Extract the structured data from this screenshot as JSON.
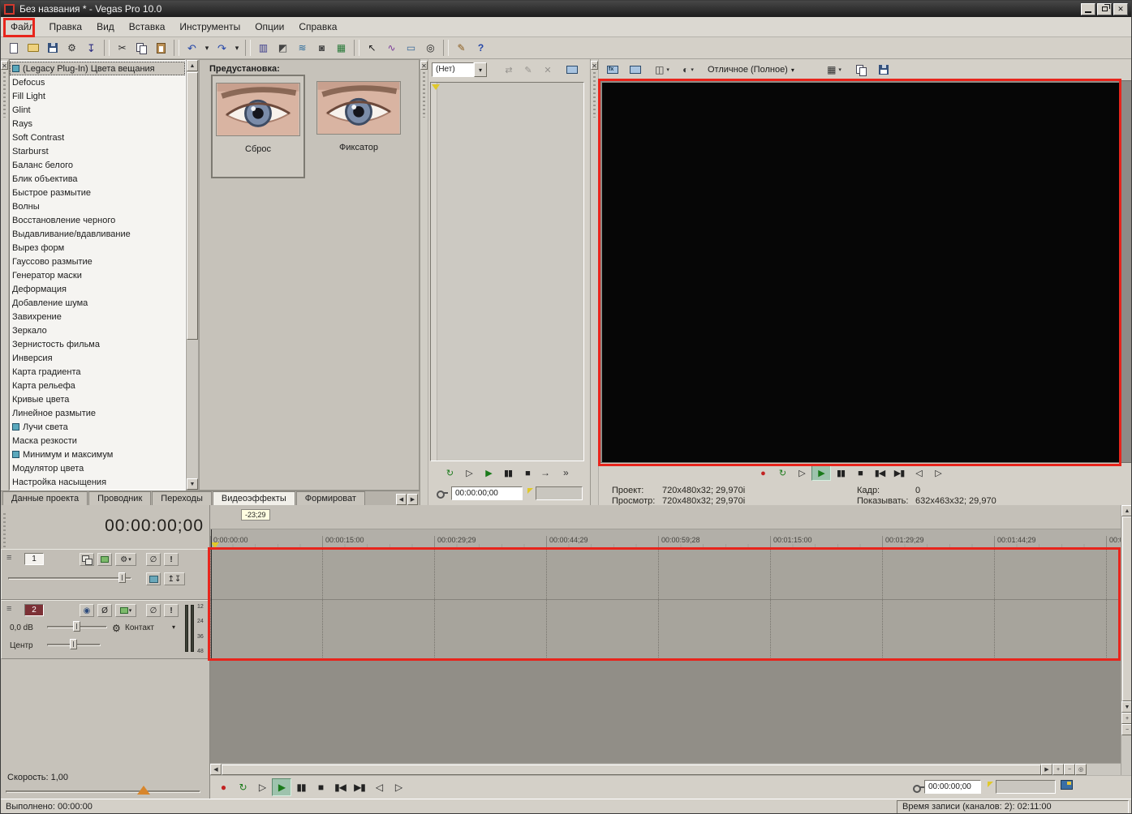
{
  "window": {
    "title": "Без названия * - Vegas Pro 10.0"
  },
  "icons": {
    "close": "✕",
    "combo_arrow": "▾",
    "collapse": "≡",
    "gear": "⚙",
    "mute": "∅",
    "solo": "!",
    "record_arm": "◉",
    "invert_phase": "Ø",
    "kf_sync": "⇄",
    "kf_edit": "✎",
    "kf_delete": "✕",
    "jump": "→",
    "more": "»",
    "split_screen": "◫",
    "preview_color": "◐",
    "grid": "▦",
    "arrow_left": "◀",
    "arrow_right": "▶",
    "arrow_up": "▲",
    "arrow_down": "▼",
    "plus": "+",
    "minus": "−",
    "zoom_tool": "◎",
    "child_up": "↥",
    "child_down": "↧"
  },
  "menu": {
    "items": [
      {
        "name": "menu-file",
        "label": "Файл"
      },
      {
        "name": "menu-edit",
        "label": "Правка"
      },
      {
        "name": "menu-view",
        "label": "Вид"
      },
      {
        "name": "menu-insert",
        "label": "Вставка"
      },
      {
        "name": "menu-tools",
        "label": "Инструменты"
      },
      {
        "name": "menu-options",
        "label": "Опции"
      },
      {
        "name": "menu-help",
        "label": "Справка"
      }
    ]
  },
  "toolbar": {
    "items": [
      {
        "name": "new-project-button",
        "icon": "page"
      },
      {
        "name": "open-button",
        "icon": "folder"
      },
      {
        "name": "save-button",
        "icon": "floppy"
      },
      {
        "name": "properties-button",
        "icon": "props"
      },
      {
        "name": "import-media-button",
        "icon": "import"
      },
      {
        "name": "toolbar-separator",
        "kind": "sep",
        "inter": false
      },
      {
        "name": "cut-button",
        "icon": "cut"
      },
      {
        "name": "copy-button",
        "icon": "copy"
      },
      {
        "name": "paste-button",
        "icon": "paste"
      },
      {
        "name": "toolbar-separator",
        "kind": "sep",
        "inter": false
      },
      {
        "name": "undo-button",
        "icon": "undo"
      },
      {
        "name": "undo-dropdown",
        "icon": "dd",
        "kind": "dd"
      },
      {
        "name": "redo-button",
        "icon": "redo"
      },
      {
        "name": "redo-dropdown",
        "icon": "dd",
        "kind": "dd"
      },
      {
        "name": "toolbar-separator",
        "kind": "sep",
        "inter": false
      },
      {
        "name": "snapping-button",
        "icon": "snap"
      },
      {
        "name": "auto-crossfades-button",
        "icon": "xfade"
      },
      {
        "name": "auto-ripple-button",
        "icon": "ripple"
      },
      {
        "name": "lock-envelopes-button",
        "icon": "lockenv"
      },
      {
        "name": "ignore-grouping-button",
        "icon": "group"
      },
      {
        "name": "toolbar-separator",
        "kind": "sep",
        "inter": false
      },
      {
        "name": "normal-edit-tool-button",
        "icon": "arrowtool"
      },
      {
        "name": "envelope-tool-button",
        "icon": "envtool"
      },
      {
        "name": "selection-tool-button",
        "icon": "seltool"
      },
      {
        "name": "zoom-tool-button",
        "icon": "zoomtool"
      },
      {
        "name": "toolbar-separator",
        "kind": "sep",
        "inter": false
      },
      {
        "name": "tutorials-button",
        "icon": "tutorial"
      },
      {
        "name": "whats-this-button",
        "icon": "help"
      }
    ]
  },
  "effects": {
    "items": [
      {
        "label": "(Legacy Plug-In) Цвета вещания",
        "selected": true,
        "icon": "plugin"
      },
      {
        "label": "Defocus"
      },
      {
        "label": "Fill Light"
      },
      {
        "label": "Glint"
      },
      {
        "label": "Rays"
      },
      {
        "label": "Soft Contrast"
      },
      {
        "label": "Starburst"
      },
      {
        "label": "Баланс белого"
      },
      {
        "label": "Блик объектива"
      },
      {
        "label": "Быстрое размытие"
      },
      {
        "label": "Волны"
      },
      {
        "label": "Восстановление черного"
      },
      {
        "label": "Выдавливание/вдавливание"
      },
      {
        "label": "Вырез форм"
      },
      {
        "label": "Гауссово размытие"
      },
      {
        "label": "Генератор маски"
      },
      {
        "label": "Деформация"
      },
      {
        "label": "Добавление шума"
      },
      {
        "label": "Завихрение"
      },
      {
        "label": "Зеркало"
      },
      {
        "label": "Зернистость фильма"
      },
      {
        "label": "Инверсия"
      },
      {
        "label": "Карта градиента"
      },
      {
        "label": "Карта рельефа"
      },
      {
        "label": "Кривые цвета"
      },
      {
        "label": "Линейное размытие"
      },
      {
        "label": "Лучи света",
        "icon": "plugin"
      },
      {
        "label": "Маска резкости"
      },
      {
        "label": "Минимум и максимум",
        "icon": "plugin"
      },
      {
        "label": "Модулятор цвета"
      },
      {
        "label": "Настройка насыщения"
      }
    ]
  },
  "presets": {
    "title": "Предустановка:",
    "items": [
      {
        "name": "preset-reset",
        "label": "Сброс",
        "selected": true
      },
      {
        "name": "preset-fixator",
        "label": "Фиксатор"
      }
    ]
  },
  "keyframes": {
    "selector_value": "(Нет)",
    "timecode": "00:00:00;00",
    "transport": [
      {
        "name": "kf-loop-button",
        "glyph": "↻",
        "cls": "g-green"
      },
      {
        "name": "kf-play-from-start-button",
        "glyph": "▷"
      },
      {
        "name": "kf-play-button",
        "glyph": "▶",
        "cls": "g-green"
      },
      {
        "name": "kf-pause-button",
        "glyph": "▮▮"
      },
      {
        "name": "kf-stop-button",
        "glyph": "■"
      }
    ]
  },
  "preview": {
    "quality": "Отличное (Полное)",
    "transport": [
      {
        "name": "pv-record-button",
        "glyph": "●",
        "cls": "g-red"
      },
      {
        "name": "pv-loop-button",
        "glyph": "↻",
        "cls": "g-green"
      },
      {
        "name": "pv-play-from-start-button",
        "glyph": "▷"
      },
      {
        "name": "pv-play-button",
        "glyph": "▶",
        "cls": "g-green",
        "active": true
      },
      {
        "name": "pv-pause-button",
        "glyph": "▮▮"
      },
      {
        "name": "pv-stop-button",
        "glyph": "■"
      },
      {
        "name": "pv-go-start-button",
        "glyph": "▮◀"
      },
      {
        "name": "pv-go-end-button",
        "glyph": "▶▮"
      },
      {
        "name": "pv-prev-frame-button",
        "glyph": "◁"
      },
      {
        "name": "pv-next-frame-button",
        "glyph": "▷"
      }
    ],
    "info": {
      "project_label": "Проект:",
      "project_value": "720x480x32; 29,970i",
      "preview_label": "Просмотр:",
      "preview_value": "720x480x32; 29,970i",
      "frame_label": "Кадр:",
      "frame_value": "0",
      "display_label": "Показывать:",
      "display_value": "632x463x32; 29,970"
    }
  },
  "tabs": {
    "items": [
      {
        "name": "tab-project-data",
        "label": "Данные проекта"
      },
      {
        "name": "tab-explorer",
        "label": "Проводник"
      },
      {
        "name": "tab-transitions",
        "label": "Переходы"
      },
      {
        "name": "tab-video-fx",
        "label": "Видеоэффекты",
        "active": true
      },
      {
        "name": "tab-generators",
        "label": "Формироват"
      }
    ]
  },
  "timeline": {
    "current_time": "00:00:00;00",
    "drag_label": "-23;29",
    "ruler": [
      {
        "label": "0:00:00:00"
      },
      {
        "label": "00:00:15:00"
      },
      {
        "label": "00:00:29;29"
      },
      {
        "label": "00:00:44;29"
      },
      {
        "label": "00:00:59;28"
      },
      {
        "label": "00:01:15:00"
      },
      {
        "label": "00:01:29;29"
      },
      {
        "label": "00:01:44;29"
      },
      {
        "label": "00:0"
      }
    ],
    "track1": {
      "number": "1"
    },
    "track2": {
      "number": "2",
      "volume": "0,0 dB",
      "device": "Контакт",
      "pan_label": "Центр",
      "meter": [
        {
          "label": "12"
        },
        {
          "label": "24"
        },
        {
          "label": "36"
        },
        {
          "label": "48"
        }
      ]
    },
    "rate_label": "Скорость: 1,00"
  },
  "transport": {
    "items": [
      {
        "name": "record-button",
        "glyph": "●",
        "cls": "g-red"
      },
      {
        "name": "loop-playback-button",
        "glyph": "↻",
        "cls": "g-green"
      },
      {
        "name": "play-from-start-button",
        "glyph": "▷"
      },
      {
        "name": "play-button",
        "glyph": "▶",
        "cls": "g-green",
        "active": true
      },
      {
        "name": "pause-button",
        "glyph": "▮▮"
      },
      {
        "name": "stop-button",
        "glyph": "■"
      },
      {
        "name": "go-to-start-button",
        "glyph": "▮◀"
      },
      {
        "name": "go-to-end-button",
        "glyph": "▶▮"
      },
      {
        "name": "prev-frame-button",
        "glyph": "◁"
      },
      {
        "name": "next-frame-button",
        "glyph": "▷"
      }
    ],
    "timecode": "00:00:00;00"
  },
  "statusbar": {
    "left": "Выполнено: 00:00:00",
    "right": "Время записи (каналов: 2): 02:11:00"
  },
  "colors": {
    "annotation": "#e8251c",
    "accent_track": "#7c3136"
  }
}
